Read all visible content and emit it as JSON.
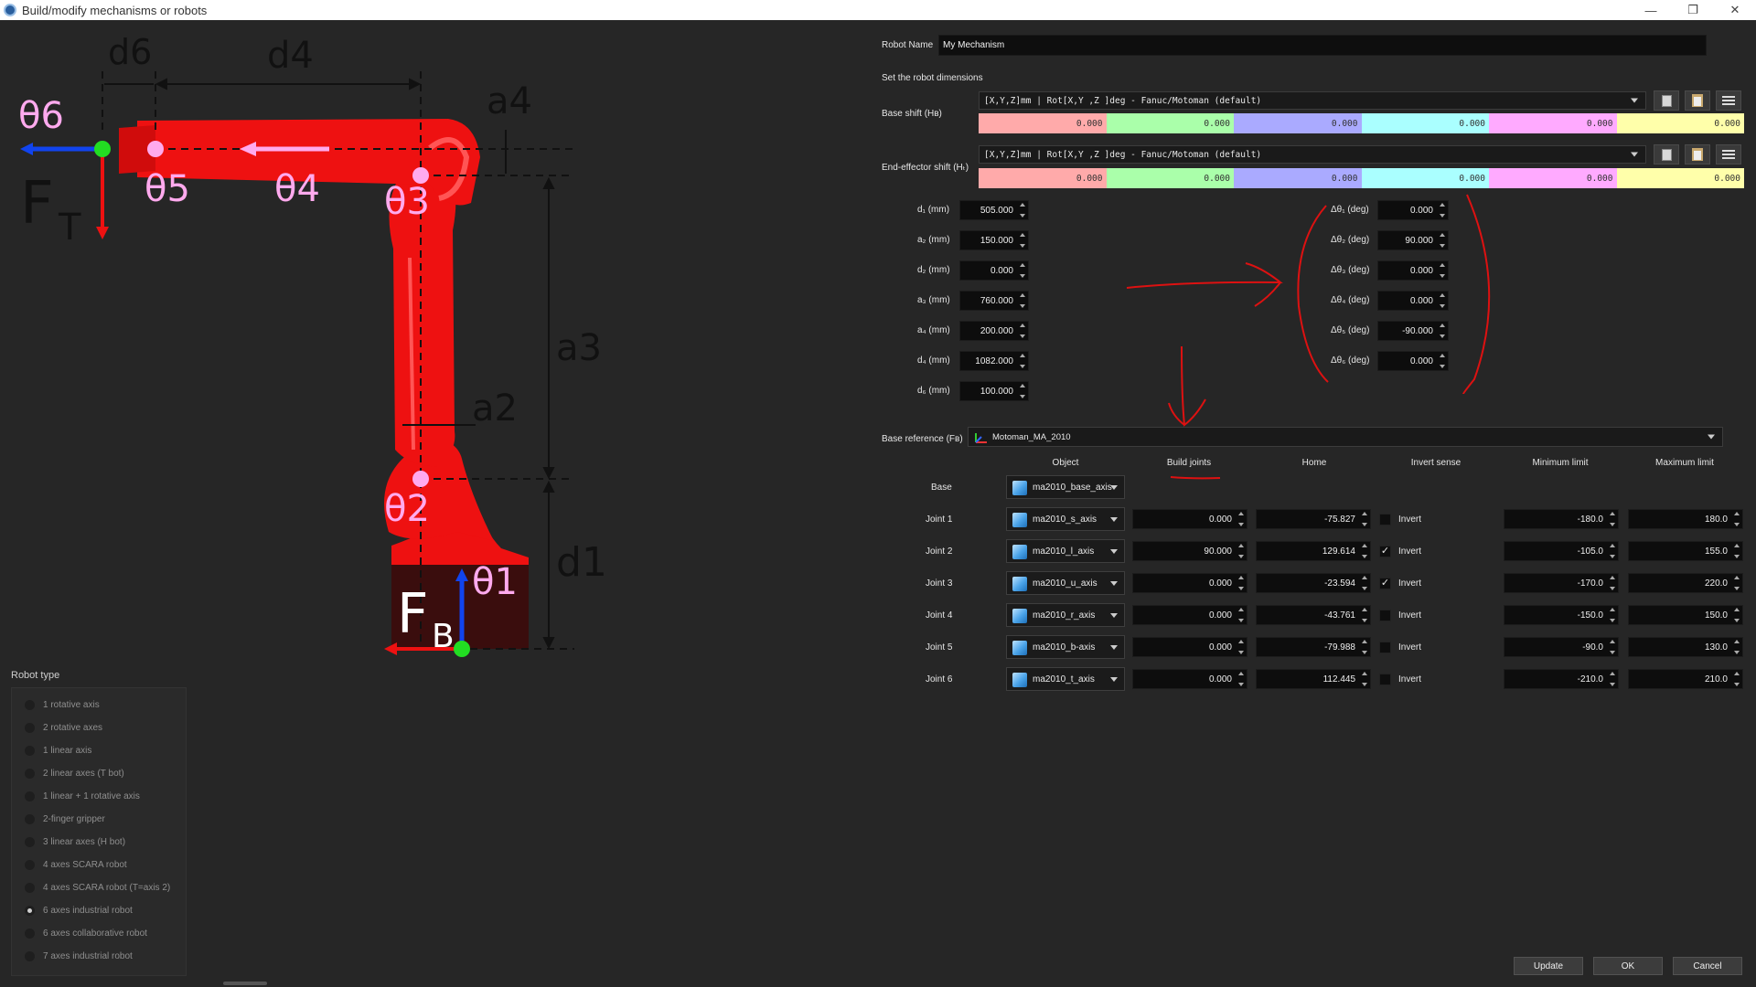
{
  "window": {
    "title": "Build/modify mechanisms or robots",
    "controls": {
      "minimize": "—",
      "restore": "❐",
      "close": "✕"
    }
  },
  "diagram": {
    "labels": {
      "d6": "d6",
      "d4": "d4",
      "a4": "a4",
      "a3": "a3",
      "a2": "a2",
      "d1": "d1",
      "theta6": "θ6",
      "theta5": "θ5",
      "theta4": "θ4",
      "theta3": "θ3",
      "theta2": "θ2",
      "theta1": "θ1",
      "ft": "F",
      "ft_sub": "T",
      "fb": "F",
      "fb_sub": "B"
    }
  },
  "robot_type": {
    "title": "Robot type",
    "options": [
      {
        "label": "1 rotative axis",
        "checked": false
      },
      {
        "label": "2 rotative axes",
        "checked": false
      },
      {
        "label": "1 linear axis",
        "checked": false
      },
      {
        "label": "2 linear axes (T bot)",
        "checked": false
      },
      {
        "label": "1 linear + 1 rotative axis",
        "checked": false
      },
      {
        "label": "2-finger gripper",
        "checked": false
      },
      {
        "label": "3 linear axes (H bot)",
        "checked": false
      },
      {
        "label": "4 axes SCARA robot",
        "checked": false
      },
      {
        "label": "4 axes SCARA robot (T=axis 2)",
        "checked": false
      },
      {
        "label": "6 axes industrial robot",
        "checked": true
      },
      {
        "label": "6 axes collaborative robot",
        "checked": false
      },
      {
        "label": "7 axes industrial robot",
        "checked": false
      }
    ]
  },
  "robot_name": {
    "label": "Robot Name",
    "value": "My Mechanism"
  },
  "dimensions_title": "Set the robot dimensions",
  "base_shift": {
    "label": "Base shift (Hʙ)",
    "format": "[X,Y,Z]mm | Rot[X,Y ,Z  ]deg - Fanuc/Motoman (default)",
    "values": [
      "0.000",
      "0.000",
      "0.000",
      "0.000",
      "0.000",
      "0.000"
    ]
  },
  "tool_shift": {
    "label": "End-effector shift (Hₜ)",
    "format": "[X,Y,Z]mm | Rot[X,Y ,Z  ]deg - Fanuc/Motoman (default)",
    "values": [
      "0.000",
      "0.000",
      "0.000",
      "0.000",
      "0.000",
      "0.000"
    ]
  },
  "shift_colors": [
    "#ffaaaa",
    "#aaffaa",
    "#aaaaff",
    "#aaffff",
    "#ffaaff",
    "#ffffaa"
  ],
  "dims": [
    {
      "label": "d₁ (mm)",
      "value": "505.000"
    },
    {
      "label": "a₂ (mm)",
      "value": "150.000"
    },
    {
      "label": "d₂ (mm)",
      "value": "0.000"
    },
    {
      "label": "a₃ (mm)",
      "value": "760.000"
    },
    {
      "label": "a₄ (mm)",
      "value": "200.000"
    },
    {
      "label": "d₄ (mm)",
      "value": "1082.000"
    },
    {
      "label": "d₆ (mm)",
      "value": "100.000"
    }
  ],
  "thetas": [
    {
      "label": "Δθ₁ (deg)",
      "value": "0.000"
    },
    {
      "label": "Δθ₂ (deg)",
      "value": "90.000"
    },
    {
      "label": "Δθ₃ (deg)",
      "value": "0.000"
    },
    {
      "label": "Δθ₄ (deg)",
      "value": "0.000"
    },
    {
      "label": "Δθ₅ (deg)",
      "value": "-90.000"
    },
    {
      "label": "Δθ₆ (deg)",
      "value": "0.000"
    }
  ],
  "base_reference": {
    "label": "Base reference (Fʙ)",
    "value": "Motoman_MA_2010"
  },
  "table": {
    "headers": {
      "object": "Object",
      "build": "Build joints",
      "home": "Home",
      "invert": "Invert sense",
      "min": "Minimum limit",
      "max": "Maximum limit"
    },
    "base": {
      "label": "Base",
      "object": "ma2010_base_axis"
    },
    "invert_label": "Invert",
    "joints": [
      {
        "label": "Joint 1",
        "object": "ma2010_s_axis",
        "build": "0.000",
        "home": "-75.827",
        "invert": false,
        "min": "-180.0",
        "max": "180.0"
      },
      {
        "label": "Joint 2",
        "object": "ma2010_l_axis",
        "build": "90.000",
        "home": "129.614",
        "invert": true,
        "min": "-105.0",
        "max": "155.0"
      },
      {
        "label": "Joint 3",
        "object": "ma2010_u_axis",
        "build": "0.000",
        "home": "-23.594",
        "invert": true,
        "min": "-170.0",
        "max": "220.0"
      },
      {
        "label": "Joint 4",
        "object": "ma2010_r_axis",
        "build": "0.000",
        "home": "-43.761",
        "invert": false,
        "min": "-150.0",
        "max": "150.0"
      },
      {
        "label": "Joint 5",
        "object": "ma2010_b-axis",
        "build": "0.000",
        "home": "-79.988",
        "invert": false,
        "min": "-90.0",
        "max": "130.0"
      },
      {
        "label": "Joint 6",
        "object": "ma2010_t_axis",
        "build": "0.000",
        "home": "112.445",
        "invert": false,
        "min": "-210.0",
        "max": "210.0"
      }
    ]
  },
  "buttons": {
    "update": "Update",
    "ok": "OK",
    "cancel": "Cancel"
  },
  "colors": {
    "robot": "#ee1111",
    "accent_green": "#22dd22",
    "accent_pink": "#ffaaee",
    "annotation": "#dd1111"
  }
}
